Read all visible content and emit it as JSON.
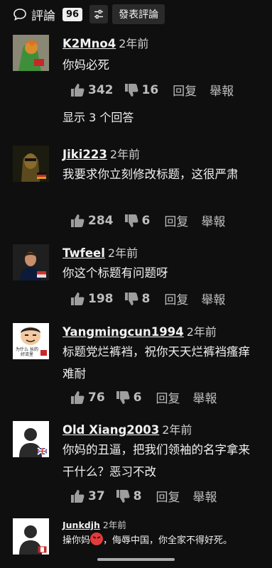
{
  "header": {
    "title": "評論",
    "count": "96",
    "post_label": "發表評論"
  },
  "comments": [
    {
      "author": "K2Mno4",
      "time": "2年前",
      "text": "你妈必死",
      "likes": "342",
      "dislikes": "16",
      "reply": "回复",
      "report": "舉報",
      "replies": "显示 3 个回答"
    },
    {
      "author": "Jiki223",
      "time": "2年前",
      "text": "我要求你立刻修改标题，这很严肃",
      "likes": "284",
      "dislikes": "6",
      "reply": "回复",
      "report": "舉報"
    },
    {
      "author": "Twfeel",
      "time": "2年前",
      "text": "你这个标题有问题呀",
      "likes": "198",
      "dislikes": "8",
      "reply": "回复",
      "report": "舉報"
    },
    {
      "author": "Yangmingcun1994",
      "time": "2年前",
      "text": "标题党烂裤裆，祝你天天烂裤裆瘙痒难耐",
      "likes": "76",
      "dislikes": "6",
      "reply": "回复",
      "report": "舉報",
      "avatar_text": "为什么 长的好流里"
    },
    {
      "author": "Old Xiang2003",
      "time": "2年前",
      "text": "你妈的丑逼，把我们领袖的名字拿来干什么？恶习不改",
      "likes": "37",
      "dislikes": "8",
      "reply": "回复",
      "report": "舉報"
    },
    {
      "author": "Junkdjh",
      "time": "2年前",
      "text_before": "操你妈",
      "text_after": "，侮辱中国，你全家不得好死。"
    }
  ]
}
